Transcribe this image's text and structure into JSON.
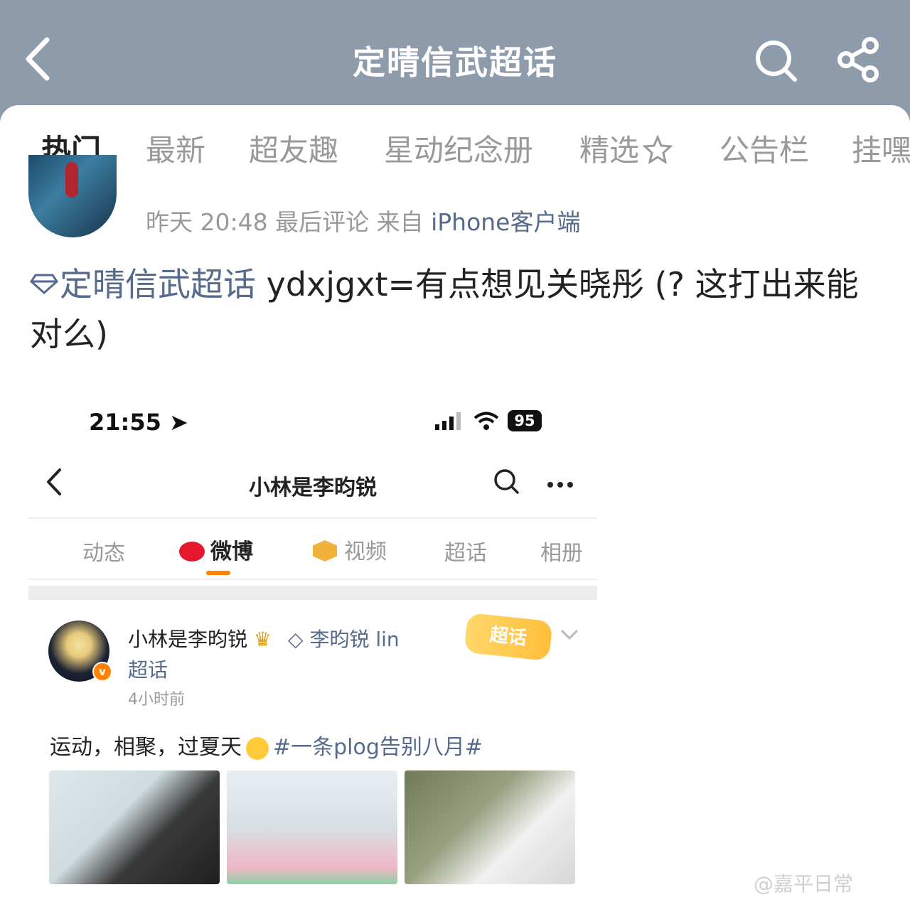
{
  "header": {
    "title": "定晴信武超话"
  },
  "tabs": [
    "热门",
    "最新",
    "超友趣",
    "星动纪念册",
    "精选",
    "公告栏",
    "挂嘿"
  ],
  "post": {
    "time": "昨天 20:48",
    "last_comment": "最后评论",
    "from_label": "来自",
    "source": "iPhone客户端",
    "topic": "定晴信武超话",
    "text": "ydxjgxt=有点想见关晓彤 (? 这打出来能对么)"
  },
  "screenshot": {
    "status_time": "21:55",
    "battery": "95",
    "nav_title": "小林是李昀锐",
    "tabs": [
      "动态",
      "微博",
      "视频",
      "超话",
      "相册"
    ],
    "user_name": "小林是李昀锐",
    "super_link": "李昀锐 lin",
    "super_link2": "超话",
    "time_ago": "4小时前",
    "sticker": "超话",
    "body_text": "运动，相聚，过夏天",
    "hashtag": "#一条plog告别八月#"
  },
  "watermark": "@嘉平日常"
}
